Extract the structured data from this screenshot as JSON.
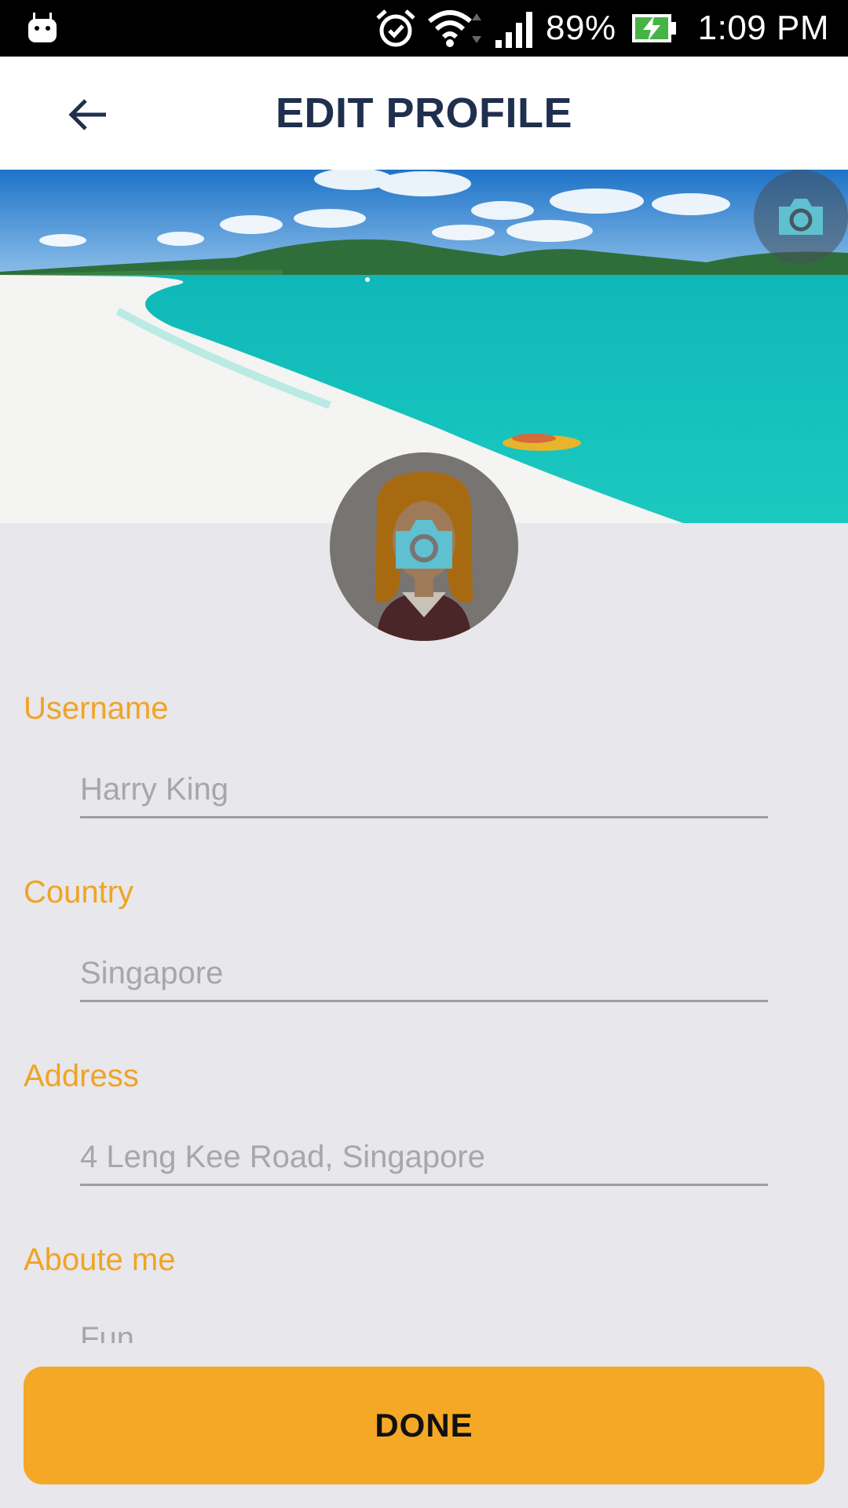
{
  "status_bar": {
    "left_icon": "android-debug-icon",
    "icons": [
      "alarm-icon",
      "wifi-icon",
      "signal-icon",
      "battery-charging-icon"
    ],
    "battery": "89%",
    "time": "1:09 PM"
  },
  "app_bar": {
    "back_icon": "arrow-left-icon",
    "title": "EDIT PROFILE"
  },
  "cover": {
    "image": "beach-photo",
    "camera_icon": "camera-icon"
  },
  "avatar": {
    "image": "woman-avatar",
    "camera_icon": "camera-icon"
  },
  "form": {
    "username": {
      "label": "Username",
      "placeholder": "Harry King"
    },
    "country": {
      "label": "Country",
      "placeholder": "Singapore"
    },
    "address": {
      "label": "Address",
      "placeholder": "4 Leng Kee Road, Singapore"
    },
    "about": {
      "label": "Aboute me",
      "value": "Fun"
    }
  },
  "done_button": {
    "label": "DONE"
  },
  "colors": {
    "accent": "#f4a825",
    "label": "#f0a424",
    "title": "#1f2f4d",
    "background": "#e7e7ec",
    "camera": "#5fc0d0"
  }
}
